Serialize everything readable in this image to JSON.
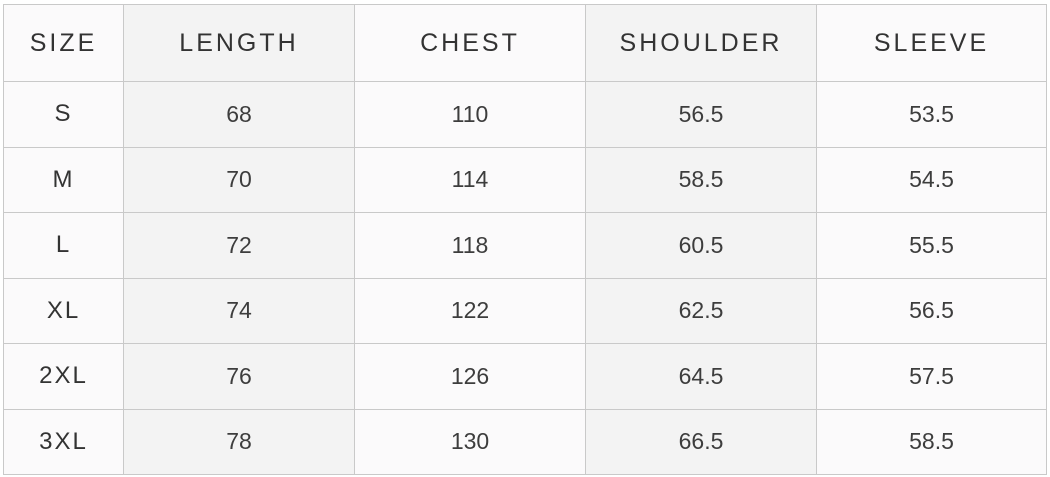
{
  "table": {
    "headers": [
      "SIZE",
      "LENGTH",
      "CHEST",
      "SHOULDER",
      "SLEEVE"
    ],
    "rows": [
      [
        "S",
        "68",
        "110",
        "56.5",
        "53.5"
      ],
      [
        "M",
        "70",
        "114",
        "58.5",
        "54.5"
      ],
      [
        "L",
        "72",
        "118",
        "60.5",
        "55.5"
      ],
      [
        "XL",
        "74",
        "122",
        "62.5",
        "56.5"
      ],
      [
        "2XL",
        "76",
        "126",
        "64.5",
        "57.5"
      ],
      [
        "3XL",
        "78",
        "130",
        "66.5",
        "58.5"
      ]
    ]
  },
  "colors": {
    "light_column": "#fbfafb",
    "dark_column": "#f3f3f3",
    "border": "#c9c9c9",
    "text": "#333333"
  }
}
